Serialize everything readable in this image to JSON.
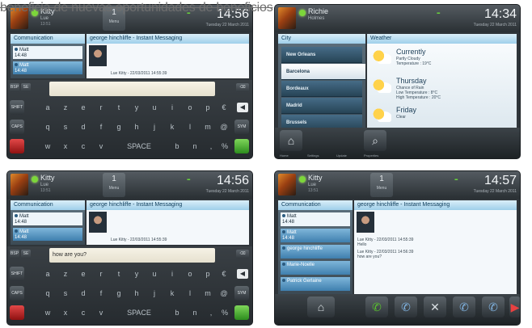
{
  "caption": "beneficia de nuevas oportunidades de beneficios",
  "colors": {
    "accent_blue": "#9fcfea",
    "presence_green": "#7cd63a",
    "dark_bg": "#2f353a",
    "input_bg": "#f6f3e6"
  },
  "screens": [
    {
      "id": "s1",
      "user": {
        "name": "Kitty",
        "status": "Lue",
        "sub": "13:51"
      },
      "tray": {
        "count": "1",
        "label": "Menu"
      },
      "clock": "14:56",
      "clock_date": "Tuesday 22 March 2011",
      "left_header": "Communication",
      "right_header": "george hinchliffe - Instant Messaging",
      "contacts": [
        "Matt",
        "Matt"
      ],
      "contacts_sub": [
        "14:48",
        "14:48"
      ],
      "chat_line": "Lue Kitty - 22/03/2011 14:55:39",
      "input_text": "",
      "kbd_left": [
        "BSP",
        "SE"
      ],
      "rows": [
        [
          "a",
          "z",
          "e",
          "r",
          "t",
          "y",
          "u",
          "i",
          "o",
          "p",
          "€"
        ],
        [
          "q",
          "s",
          "d",
          "f",
          "g",
          "h",
          "j",
          "k",
          "l",
          "m",
          "@"
        ],
        [
          "w",
          "x",
          "c",
          "v",
          "SPACE",
          "b",
          "n",
          ",",
          "%"
        ]
      ],
      "side_keys": [
        "SHIFT",
        "CAPS LOCK",
        "SYM"
      ]
    },
    {
      "id": "s2",
      "user": {
        "name": "Richie",
        "status": "Holmes",
        "sub": ""
      },
      "clock": "14:34",
      "clock_date": "Tuesday 22 March 2011",
      "left_header": "City",
      "right_header": "Weather",
      "cities": [
        "New Orleans",
        "Barcelona",
        "Bordeaux",
        "Madrid",
        "Brussels"
      ],
      "weather": [
        {
          "title": "Currently",
          "lines": [
            "Partly Cloudy",
            "Temperature : 19°C"
          ]
        },
        {
          "title": "Thursday",
          "lines": [
            "Chance of Rain",
            "Low Temperature : 8°C",
            "High Temperature : 20°C"
          ]
        },
        {
          "title": "Friday",
          "lines": [
            "Clear"
          ]
        }
      ],
      "dock_labels": [
        "Home",
        "Settings",
        "Update",
        "Properties"
      ]
    },
    {
      "id": "s3",
      "user": {
        "name": "Kitty",
        "status": "Lue",
        "sub": "13:51"
      },
      "tray": {
        "count": "1",
        "label": "Menu"
      },
      "clock": "14:56",
      "clock_date": "Tuesday 22 March 2011",
      "left_header": "Communication",
      "right_header": "george hinchliffe - Instant Messaging",
      "contacts": [
        "Matt",
        "Matt"
      ],
      "contacts_sub": [
        "14:48",
        "14:48"
      ],
      "chat_line": "Lue Kitty - 22/03/2011 14:55:39",
      "input_text": "how are you?",
      "kbd_left": [
        "BSP",
        "SE"
      ],
      "rows": [
        [
          "a",
          "z",
          "e",
          "r",
          "t",
          "y",
          "u",
          "i",
          "o",
          "p",
          "€"
        ],
        [
          "q",
          "s",
          "d",
          "f",
          "g",
          "h",
          "j",
          "k",
          "l",
          "m",
          "@"
        ],
        [
          "w",
          "x",
          "c",
          "v",
          "SPACE",
          "b",
          "n",
          ",",
          "%"
        ]
      ],
      "side_keys": [
        "SHIFT",
        "CAPS LOCK",
        "SYM"
      ]
    },
    {
      "id": "s4",
      "user": {
        "name": "Kitty",
        "status": "Lue",
        "sub": "13:51"
      },
      "tray": {
        "count": "1",
        "label": "Menu"
      },
      "clock": "14:57",
      "clock_date": "Tuesday 22 March 2011",
      "left_header": "Communication",
      "right_header": "george hinchliffe - Instant Messaging",
      "contacts": [
        "Matt",
        "Matt",
        "george hinchliffe",
        "Marie-Noelle",
        "Patrick Gerlaine"
      ],
      "contacts_sub": [
        "14:48",
        "14:48",
        "",
        "",
        ""
      ],
      "chat_lines": [
        "Lue Kitty - 22/03/2011 14:55:39",
        "Hello",
        "Lue Kitty - 22/03/2011 14:56:39",
        "how are you?"
      ]
    }
  ]
}
